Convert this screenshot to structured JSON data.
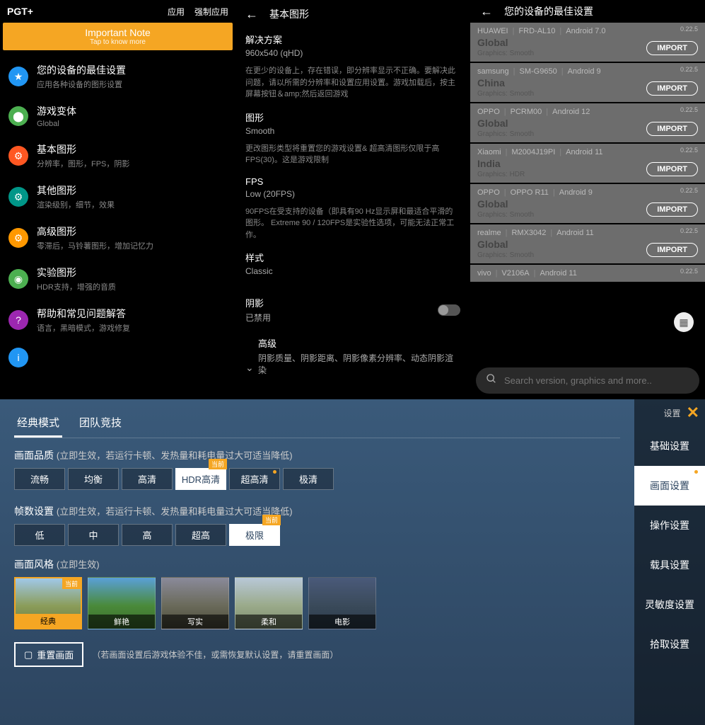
{
  "panel1": {
    "appTitle": "PGT+",
    "headerLinks": [
      "应用",
      "强制应用"
    ],
    "note": {
      "title": "Important Note",
      "sub": "Tap to know more"
    },
    "items": [
      {
        "icon": "star",
        "title": "您的设备的最佳设置",
        "sub": "应用各种设备的图形设置"
      },
      {
        "icon": "game",
        "title": "游戏变体",
        "sub": "Global"
      },
      {
        "icon": "basic",
        "title": "基本图形",
        "sub": "分辨率，图形，FPS，阴影"
      },
      {
        "icon": "other",
        "title": "其他图形",
        "sub": "渲染级别，细节，效果"
      },
      {
        "icon": "adv",
        "title": "高级图形",
        "sub": "零滞后，马铃薯图形，增加记忆力"
      },
      {
        "icon": "exp",
        "title": "实验图形",
        "sub": "HDR支持，增强的音质"
      },
      {
        "icon": "help",
        "title": "帮助和常见问题解答",
        "sub": "语言，黑暗模式，游戏修复"
      },
      {
        "icon": "info",
        "title": "",
        "sub": ""
      }
    ]
  },
  "panel2": {
    "title": "基本图形",
    "blocks": {
      "resolution": {
        "label": "解决方案",
        "value": "960x540 (qHD)",
        "desc": "在更少的设备上，存在错误，即分辨率显示不正确。要解决此问题，请以所需的分辨率和设置应用设置。游戏加载后，按主屏幕按钮＆amp;然后返回游戏"
      },
      "graphics": {
        "label": "图形",
        "value": "Smooth",
        "desc": "更改图形类型将重置您的游戏设置& 超高清图形仅限于高 FPS(30)。这是游戏限制"
      },
      "fps": {
        "label": "FPS",
        "value": "Low (20FPS)",
        "desc": "90FPS在受支持的设备（即具有90 Hz显示屏和最适合平滑的图形。 Extreme 90 / 120FPS是实验性选项，可能无法正常工作。"
      },
      "style": {
        "label": "样式",
        "value": "Classic"
      },
      "shadow": {
        "label": "阴影",
        "value": "已禁用"
      },
      "advanced": {
        "label": "高级",
        "value": "阴影质量、阴影距离、阴影像素分辨率、动态阴影渲染"
      }
    }
  },
  "panel3": {
    "title": "您的设备的最佳设置",
    "version": "0.22.5",
    "importLabel": "IMPORT",
    "devices": [
      {
        "brand": "HUAWEI",
        "model": "FRD-AL10",
        "os": "Android 7.0",
        "region": "Global",
        "gfx": "Graphics: Smooth"
      },
      {
        "brand": "samsung",
        "model": "SM-G9650",
        "os": "Android 9",
        "region": "China",
        "gfx": "Graphics: Smooth"
      },
      {
        "brand": "OPPO",
        "model": "PCRM00",
        "os": "Android 12",
        "region": "Global",
        "gfx": "Graphics: Smooth"
      },
      {
        "brand": "Xiaomi",
        "model": "M2004J19PI",
        "os": "Android 11",
        "region": "India",
        "gfx": "Graphics: HDR"
      },
      {
        "brand": "OPPO",
        "model": "OPPO R11",
        "os": "Android 9",
        "region": "Global",
        "gfx": "Graphics: Smooth"
      },
      {
        "brand": "realme",
        "model": "RMX3042",
        "os": "Android 11",
        "region": "Global",
        "gfx": "Graphics: Smooth"
      },
      {
        "brand": "vivo",
        "model": "V2106A",
        "os": "Android 11",
        "region": "",
        "gfx": ""
      }
    ],
    "searchPlaceholder": "Search version, graphics and more.."
  },
  "panel4": {
    "topTabs": [
      "经典模式",
      "团队竞技"
    ],
    "quality": {
      "title": "画面品质",
      "hint": "(立即生效，若运行卡顿、发热量和耗电量过大可适当降低)",
      "options": [
        "流畅",
        "均衡",
        "高清",
        "HDR高清",
        "超高清",
        "极清"
      ],
      "active": 3,
      "badge": "当前"
    },
    "fps": {
      "title": "帧数设置",
      "hint": "(立即生效，若运行卡顿、发热量和耗电量过大可适当降低)",
      "options": [
        "低",
        "中",
        "高",
        "超高",
        "极限"
      ],
      "active": 4,
      "badge": "当前"
    },
    "style": {
      "title": "画面风格",
      "hint": "(立即生效)",
      "options": [
        "经典",
        "鲜艳",
        "写实",
        "柔和",
        "电影"
      ],
      "active": 0,
      "badge": "当前"
    },
    "reset": {
      "label": "重置画面",
      "hint": "（若画面设置后游戏体验不佳，或需恢复默认设置，请重置画面）"
    },
    "sideLabel": "设置",
    "sideTabs": [
      "基础设置",
      "画面设置",
      "操作设置",
      "载具设置",
      "灵敏度设置",
      "拾取设置"
    ],
    "sideActive": 1
  }
}
